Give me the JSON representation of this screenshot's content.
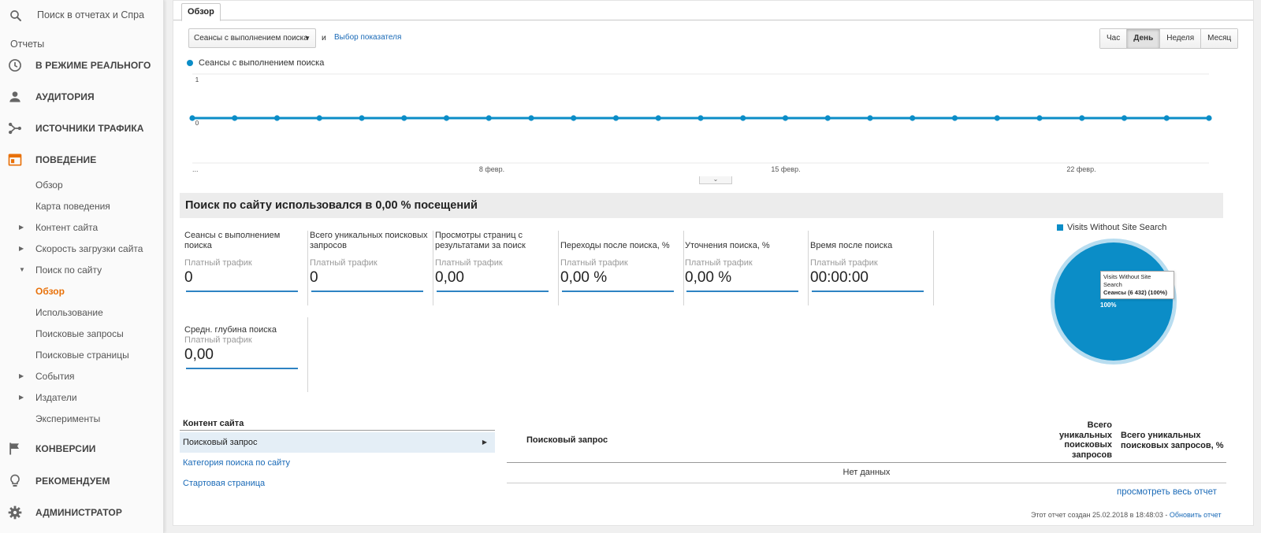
{
  "sidebar": {
    "search_placeholder": "Поиск в отчетах и Справк",
    "reports_label": "Отчеты",
    "main_items": [
      {
        "label": "В РЕЖИМЕ РЕАЛЬНОГО",
        "icon": "clock-icon"
      },
      {
        "label": "АУДИТОРИЯ",
        "icon": "person-icon"
      },
      {
        "label": "ИСТОЧНИКИ ТРАФИКА",
        "icon": "acquisition-icon"
      },
      {
        "label": "ПОВЕДЕНИЕ",
        "icon": "behavior-icon",
        "active": true
      },
      {
        "label": "КОНВЕРСИИ",
        "icon": "flag-icon"
      },
      {
        "label": "РЕКОМЕНДУЕМ",
        "icon": "lightbulb-icon"
      },
      {
        "label": "АДМИНИСТРАТОР",
        "icon": "gear-icon"
      }
    ],
    "sub_items": [
      {
        "label": "Обзор",
        "arrow": ""
      },
      {
        "label": "Карта поведения",
        "arrow": ""
      },
      {
        "label": "Контент сайта",
        "arrow": "▶"
      },
      {
        "label": "Скорость загрузки сайта",
        "arrow": "▶"
      },
      {
        "label": "Поиск по сайту",
        "arrow": "▼"
      },
      {
        "label": "Обзор",
        "arrow": "",
        "active": true
      },
      {
        "label": "Использование",
        "arrow": ""
      },
      {
        "label": "Поисковые запросы",
        "arrow": ""
      },
      {
        "label": "Поисковые страницы",
        "arrow": ""
      },
      {
        "label": "События",
        "arrow": "▶"
      },
      {
        "label": "Издатели",
        "arrow": "▶"
      },
      {
        "label": "Эксперименты",
        "arrow": ""
      }
    ]
  },
  "main": {
    "tab": "Обзор",
    "metric_select": "Сеансы с выполнением поиска",
    "and_label": "и",
    "metric_link": "Выбор показателя",
    "periods": [
      {
        "label": "Час",
        "active": false
      },
      {
        "label": "День",
        "active": true
      },
      {
        "label": "Неделя",
        "active": false
      },
      {
        "label": "Месяц",
        "active": false
      }
    ],
    "summary_title": "Поиск по сайту использовался в 0,00 % посещений",
    "metrics": [
      {
        "title": "Сеансы с выполнением поиска",
        "sub": "Платный трафик",
        "value": "0"
      },
      {
        "title": "Всего уникальных поисковых запросов",
        "sub": "Платный трафик",
        "value": "0"
      },
      {
        "title": "Просмотры страниц с результатами за поиск",
        "sub": "Платный трафик",
        "value": "0,00"
      },
      {
        "title": "Переходы после поиска, %",
        "sub": "Платный трафик",
        "value": "0,00 %"
      },
      {
        "title": "Уточнения поиска, %",
        "sub": "Платный трафик",
        "value": "0,00 %"
      },
      {
        "title": "Время после поиска",
        "sub": "Платный трафик",
        "value": "00:00:00"
      },
      {
        "title": "Средн. глубина поиска",
        "sub": "Платный трафик",
        "value": "0,00"
      }
    ],
    "pie": {
      "legend": "Visits Without Site Search",
      "tooltip_title": "Visits Without Site Search",
      "tooltip_value": "Сеансы (6 432) (100%)",
      "center_label": "100%",
      "color": "#0b8dc7"
    },
    "content": {
      "heading": "Контент сайта",
      "items": [
        {
          "label": "Поисковый запрос",
          "active": true
        },
        {
          "label": "Категория поиска по сайту",
          "active": false
        },
        {
          "label": "Стартовая страница",
          "active": false
        }
      ]
    },
    "table": {
      "col_query": "Поисковый запрос",
      "col_unique": "Всего уникальных поисковых запросов",
      "col_unique_pct": "Всего уникальных поисковых запросов, %",
      "empty": "Нет данных"
    },
    "full_report": "просмотреть весь отчет",
    "footer": "Этот отчет создан 25.02.2018 в 18:48:03 - ",
    "footer_refresh": "Обновить отчет"
  },
  "chart_data": {
    "type": "line",
    "series": [
      {
        "name": "Сеансы с выполнением поиска",
        "values": [
          0,
          0,
          0,
          0,
          0,
          0,
          0,
          0,
          0,
          0,
          0,
          0,
          0,
          0,
          0,
          0,
          0,
          0,
          0,
          0,
          0,
          0,
          0,
          0,
          0
        ]
      }
    ],
    "x_ticks": [
      "...",
      "8 февр.",
      "15 февр.",
      "22 февр."
    ],
    "y_ticks": [
      "1",
      "0"
    ],
    "ylim": [
      0,
      1
    ],
    "color": "#0b8dc7",
    "grid": true
  }
}
